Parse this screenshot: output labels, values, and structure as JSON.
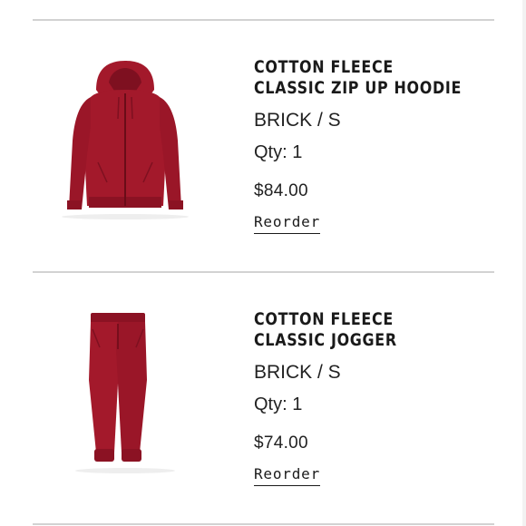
{
  "orders": [
    {
      "name_line1": "COTTON FLEECE",
      "name_line2": "CLASSIC ZIP UP HOODIE",
      "variant": "BRICK / S",
      "qty_label": "Qty:",
      "qty_value": "1",
      "price": "$84.00",
      "reorder_label": "Reorder",
      "image_icon": "hoodie-image"
    },
    {
      "name_line1": "COTTON FLEECE",
      "name_line2": "CLASSIC JOGGER",
      "variant": "BRICK / S",
      "qty_label": "Qty:",
      "qty_value": "1",
      "price": "$74.00",
      "reorder_label": "Reorder",
      "image_icon": "jogger-image"
    }
  ],
  "colors": {
    "garment": "#a3192b",
    "garment_dark": "#7e1020",
    "divider": "#d2d2d2",
    "text": "#1a1a1a"
  }
}
